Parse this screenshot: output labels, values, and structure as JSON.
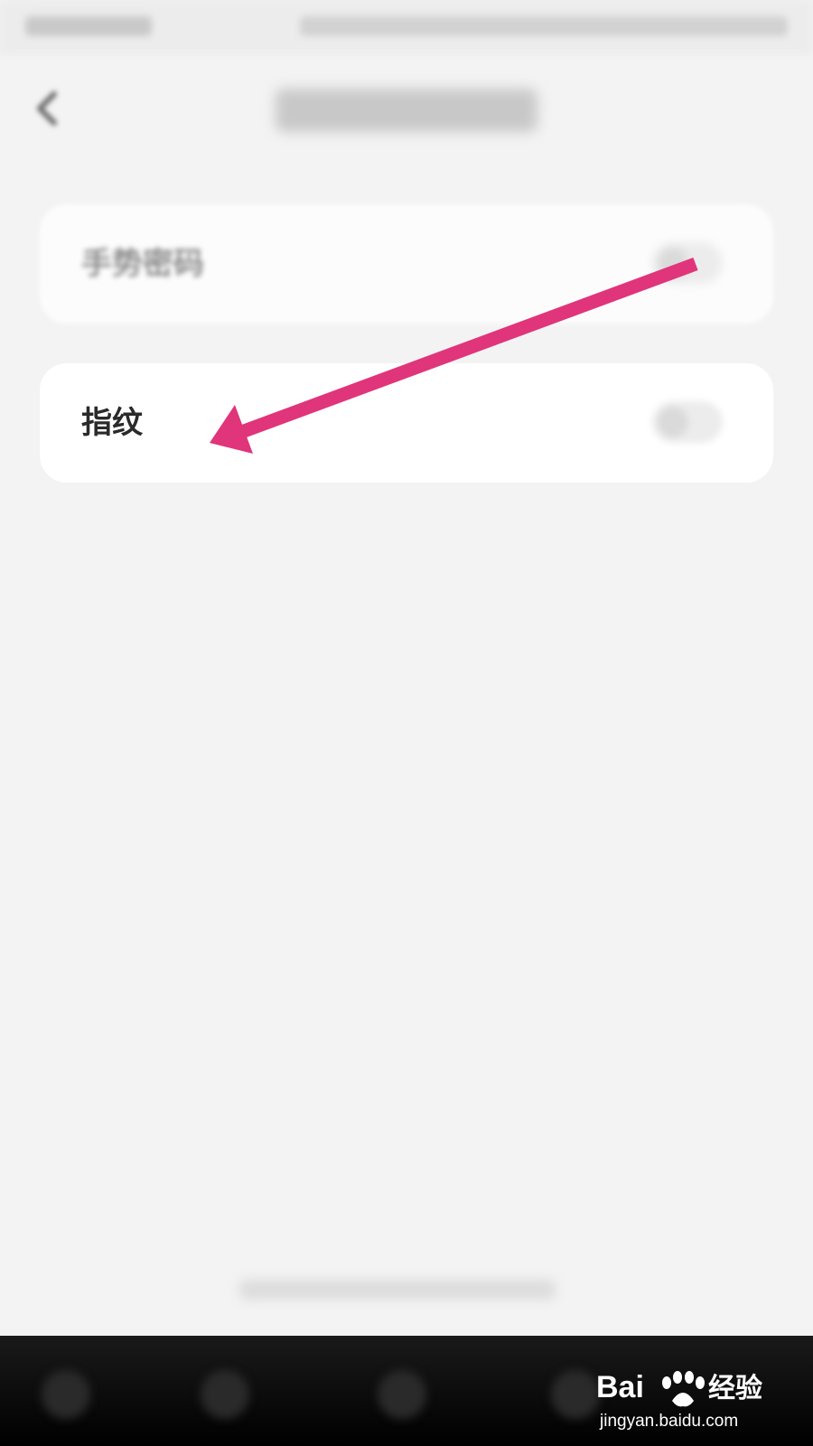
{
  "settings": {
    "items": [
      {
        "label": "手势密码",
        "enabled": false
      },
      {
        "label": "指纹",
        "enabled": false
      }
    ]
  },
  "annotation": {
    "color": "#e0357a",
    "icon": "arrow-icon"
  },
  "watermark": {
    "text": "Baidu 经验",
    "url": "jingyan.baidu.com"
  },
  "icons": {
    "back": "back-chevron-icon",
    "nav_menu": "menu-icon",
    "nav_back": "nav-back-icon",
    "nav_home": "home-icon",
    "nav_recent": "recent-apps-icon"
  }
}
